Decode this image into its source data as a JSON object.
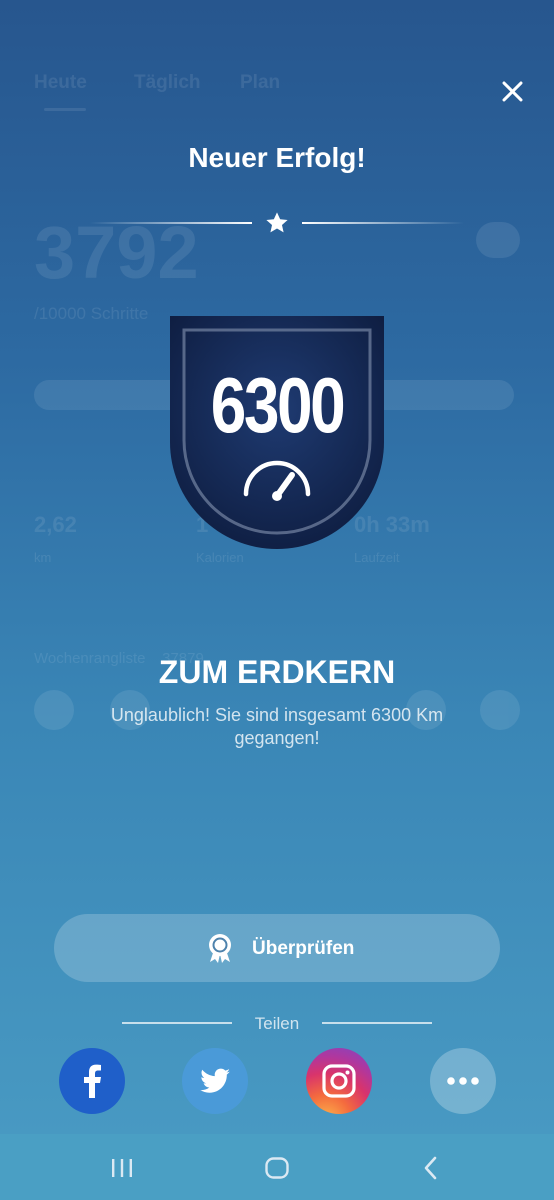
{
  "background": {
    "tabs": [
      "Heute",
      "Täglich",
      "Plan"
    ],
    "steps": "3792",
    "goal": "/10000 Schritte",
    "stats": [
      {
        "value": "2,62",
        "unit": "km"
      },
      {
        "value": "1",
        "unit": "Kalorien"
      },
      {
        "value": "0h 33m",
        "unit": "Laufzeit"
      }
    ],
    "row_label": "Wochenrangliste",
    "row_value": "37879"
  },
  "dialog": {
    "title": "Neuer Erfolg!",
    "badge_value": "6300",
    "achievement_title": "ZUM ERDKERN",
    "achievement_desc": "Unglaublich! Sie sind insgesamt 6300 Km gegangen!",
    "review_label": "Überprüfen",
    "share_label": "Teilen"
  },
  "share_buttons": [
    {
      "name": "facebook",
      "color": "#1f5fc9"
    },
    {
      "name": "twitter",
      "color": "#4a9ad8"
    },
    {
      "name": "instagram",
      "color": "#d9346b"
    },
    {
      "name": "more",
      "color": "#ffffff"
    }
  ],
  "nav": [
    "recent-apps",
    "home",
    "back"
  ],
  "colors": {
    "background_top": "#27568e",
    "background_bottom": "#4a9cc4",
    "badge_dark": "#0f1f44",
    "nav_bar": "#4a9fc4"
  }
}
